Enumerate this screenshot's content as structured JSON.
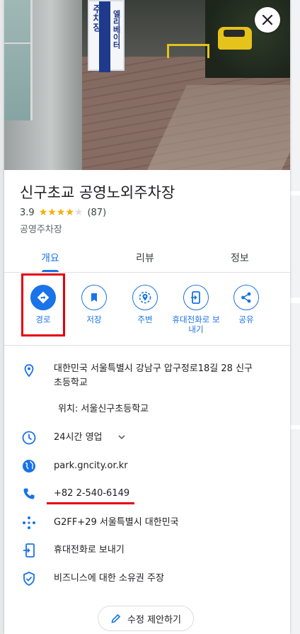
{
  "panel": {
    "title": "신구초교 공영노외주차장",
    "rating": "3.9",
    "rating_value": 3.9,
    "review_count": "(87)",
    "category": "공영주차장",
    "photo_sign_text": "주차장",
    "photo_sign_text2": "엘리베이터"
  },
  "tabs": [
    {
      "label": "개요",
      "active": true
    },
    {
      "label": "리뷰",
      "active": false
    },
    {
      "label": "정보",
      "active": false
    }
  ],
  "actions": [
    {
      "label": "경로",
      "icon": "directions-icon"
    },
    {
      "label": "저장",
      "icon": "bookmark-icon"
    },
    {
      "label": "주변",
      "icon": "nearby-icon"
    },
    {
      "label": "휴대전화로 보\n내기",
      "icon": "send-to-phone-icon"
    },
    {
      "label": "공유",
      "icon": "share-icon"
    }
  ],
  "info": {
    "address_line1": "대한민국 서울특별시 강남구 압구정로18길 28 신구",
    "address_line2": "초등학교",
    "located_in": "위치: 서울신구초등학교",
    "hours": "24시간 영업",
    "website": "park.gncity.or.kr",
    "phone": "+82 2-540-6149",
    "plus_code": "G2FF+29 서울특별시 대한민국",
    "send_to_phone": "휴대전화로 보내기",
    "claim_business": "비즈니스에 대한 소유권 주장"
  },
  "suggest_edit": "수정 제안하기",
  "colors": {
    "accent": "#1a73e8",
    "star": "#f9ab00",
    "open_green": "#188038",
    "highlight_red": "#e4000f"
  }
}
